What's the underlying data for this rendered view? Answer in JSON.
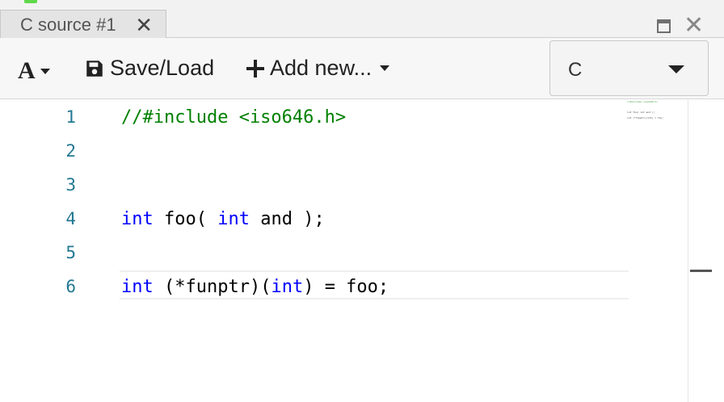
{
  "tab": {
    "title": "C source #1",
    "close_glyph": "✕"
  },
  "window": {
    "close_glyph": "✕"
  },
  "toolbar": {
    "font_glyph": "A",
    "save_label": "Save/Load",
    "add_label": "Add new...",
    "language_value": "C"
  },
  "editor": {
    "lines": [
      {
        "number": "1",
        "text": "//#include <iso646.h>"
      },
      {
        "number": "2",
        "text": ""
      },
      {
        "number": "3",
        "text": ""
      },
      {
        "number": "4",
        "text": "int foo( int and );"
      },
      {
        "number": "5",
        "text": ""
      },
      {
        "number": "6",
        "text": "int (*funptr)(int) = foo;"
      }
    ],
    "tokens": {
      "l1_comment": "//#include <iso646.h>",
      "l4_kw1": "int",
      "l4_mid": " foo( ",
      "l4_kw2": "int",
      "l4_end": " and );",
      "l6_kw1": "int",
      "l6_mid": " (*funptr)(",
      "l6_kw2": "int",
      "l6_end": ") = foo;"
    }
  },
  "colors": {
    "comment": "#008000",
    "keyword": "#0000ff",
    "line_number": "#237893"
  },
  "icons": {
    "font": "font-size-icon",
    "save": "floppy-disk-icon",
    "add": "plus-icon",
    "maximize": "maximize-icon",
    "close": "close-icon"
  }
}
